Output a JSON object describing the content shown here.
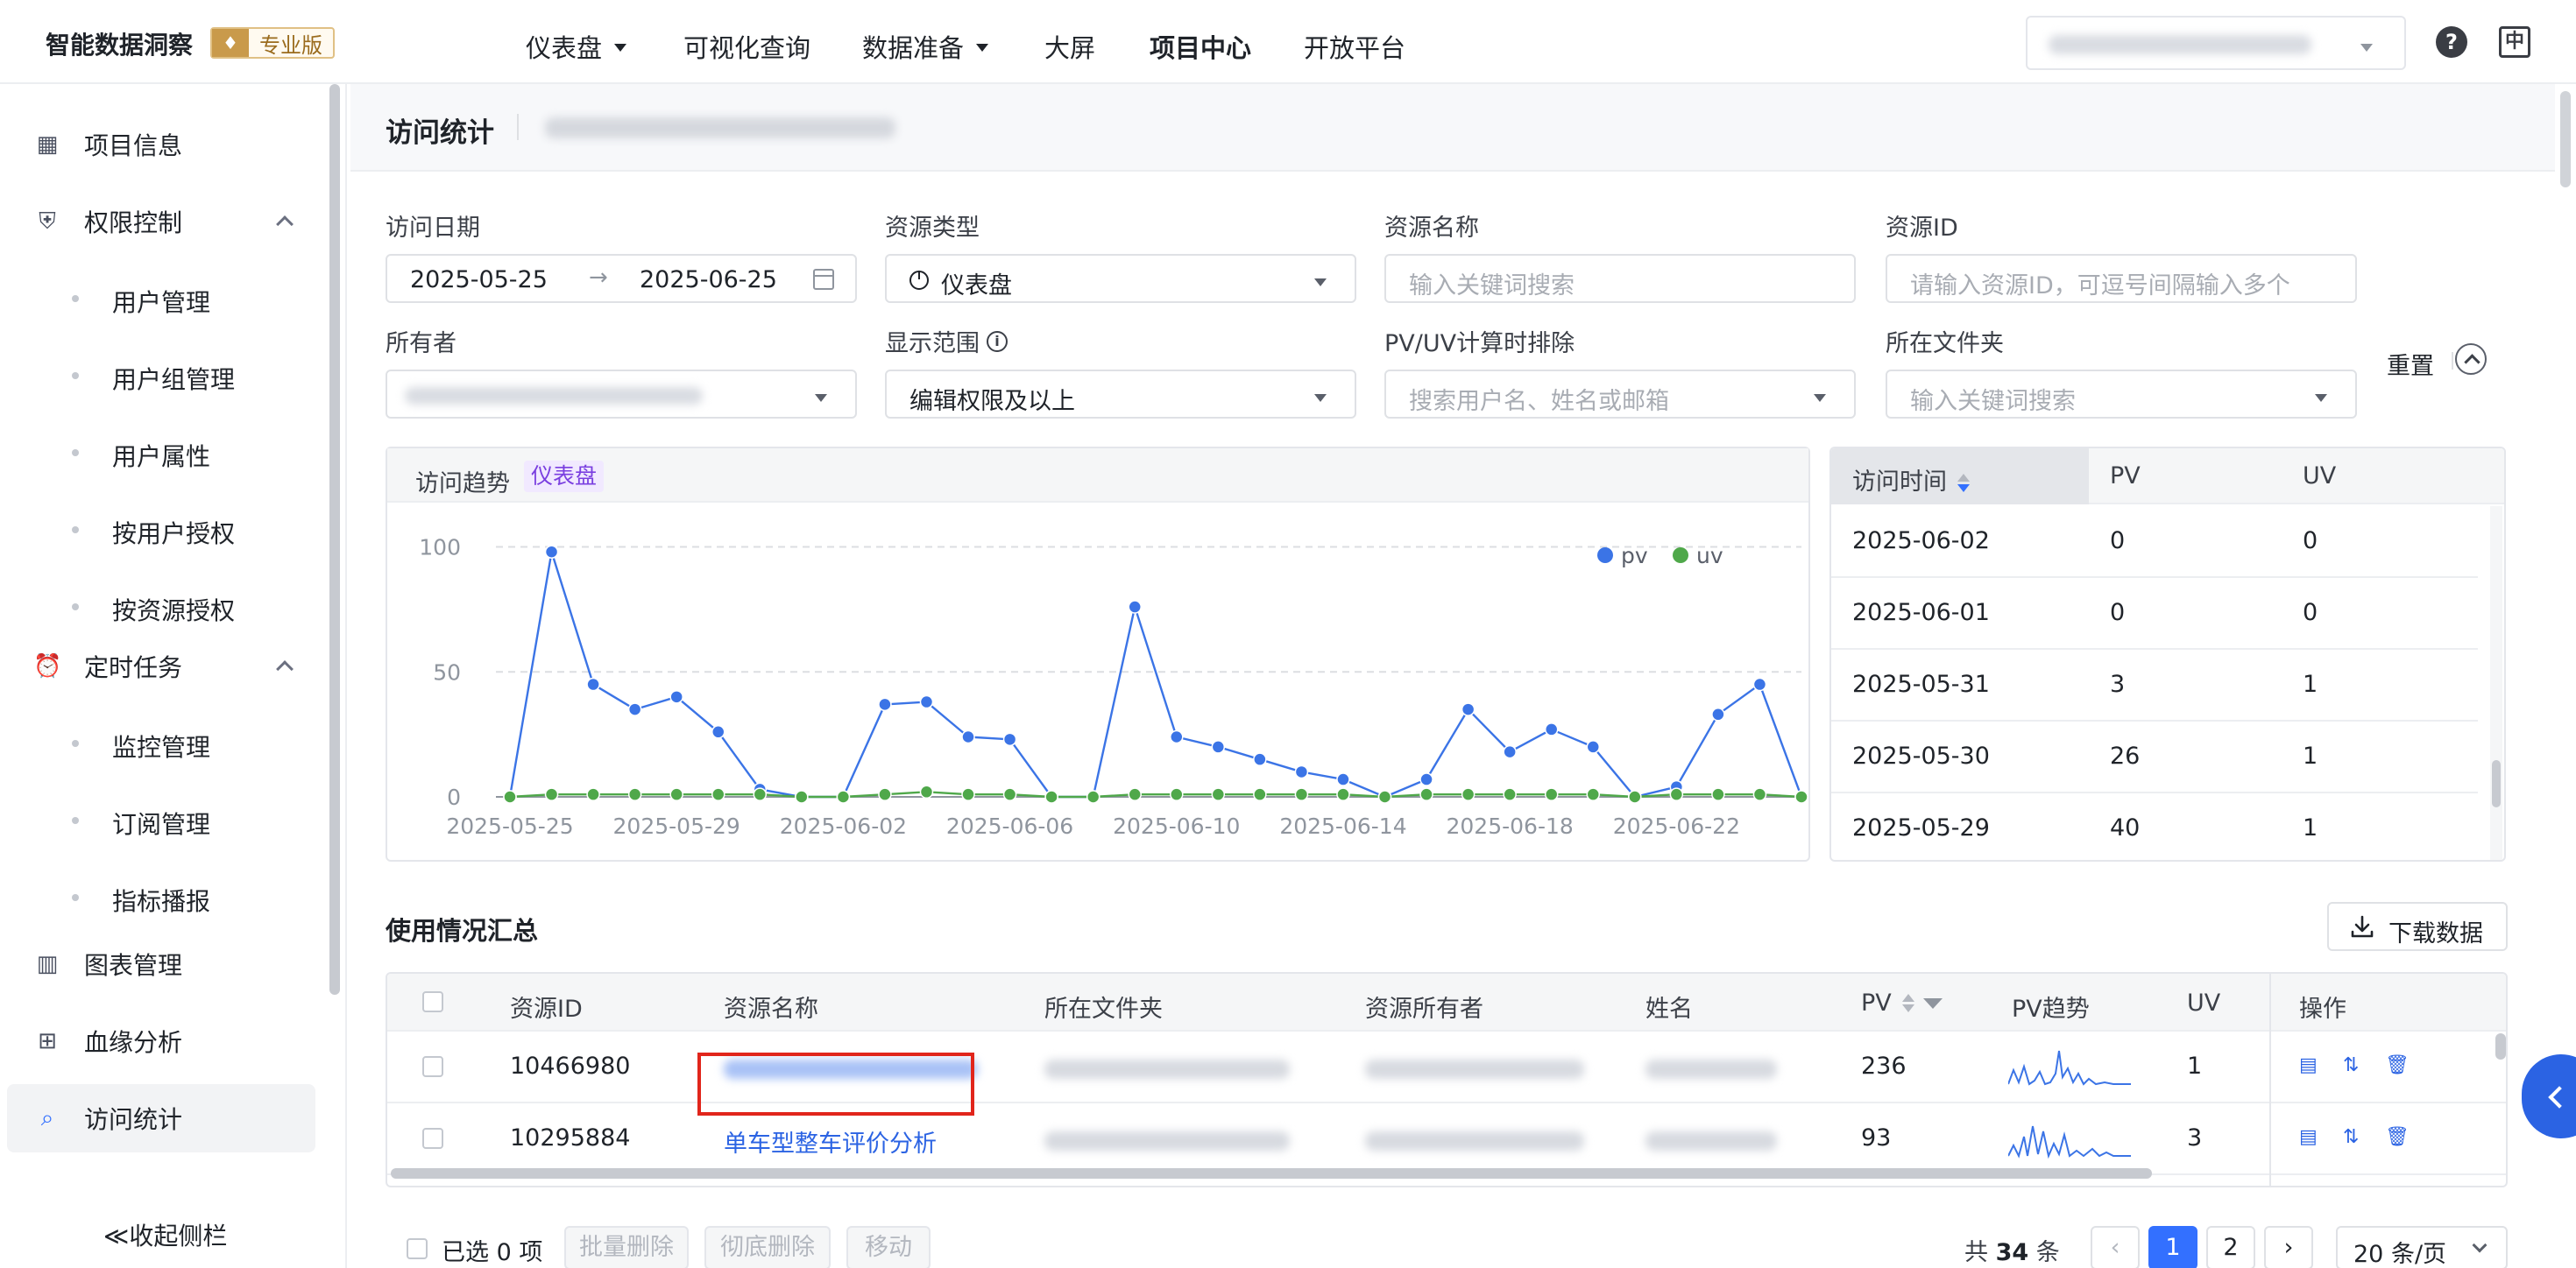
{
  "topnav": {
    "brand": "智能数据洞察",
    "edition": "专业版",
    "items": [
      "仪表盘",
      "可视化查询",
      "数据准备",
      "大屏",
      "项目中心",
      "开放平台"
    ],
    "help_icon": "question-circle-icon",
    "lang_icon": "chinese-language-icon"
  },
  "sidebar": {
    "items": [
      {
        "label": "项目信息",
        "icon": "grid-icon"
      },
      {
        "label": "权限控制",
        "icon": "shield-icon"
      },
      {
        "label": "用户管理"
      },
      {
        "label": "用户组管理"
      },
      {
        "label": "用户属性"
      },
      {
        "label": "按用户授权"
      },
      {
        "label": "按资源授权"
      },
      {
        "label": "定时任务",
        "icon": "alarm-clock-icon"
      },
      {
        "label": "监控管理"
      },
      {
        "label": "订阅管理"
      },
      {
        "label": "指标播报"
      },
      {
        "label": "图表管理",
        "icon": "bar-chart-icon"
      },
      {
        "label": "血缘分析",
        "icon": "lineage-icon"
      },
      {
        "label": "访问统计",
        "icon": "stats-search-icon"
      }
    ],
    "collapse_label": "≪收起侧栏"
  },
  "page": {
    "title": "访问统计"
  },
  "filters": {
    "date_label": "访问日期",
    "date_start": "2025-05-25",
    "date_arrow": "→",
    "date_end": "2025-06-25",
    "type_label": "资源类型",
    "type_value": "仪表盘",
    "name_label": "资源名称",
    "name_placeholder": "输入关键词搜索",
    "id_label": "资源ID",
    "id_placeholder": "请输入资源ID，可逗号间隔输入多个",
    "reset": "重置",
    "owner_label": "所有者",
    "scope_label": "显示范围",
    "scope_value": "编辑权限及以上",
    "exclude_label": "PV/UV计算时排除",
    "exclude_placeholder": "搜索用户名、姓名或邮箱",
    "folder_label": "所在文件夹",
    "folder_placeholder": "输入关键词搜索"
  },
  "trend": {
    "title": "访问趋势",
    "tag": "仪表盘"
  },
  "chart_data": {
    "type": "line",
    "x": [
      "2025-05-25",
      "2025-05-26",
      "2025-05-27",
      "2025-05-28",
      "2025-05-29",
      "2025-05-30",
      "2025-05-31",
      "2025-06-01",
      "2025-06-02",
      "2025-06-03",
      "2025-06-04",
      "2025-06-05",
      "2025-06-06",
      "2025-06-07",
      "2025-06-08",
      "2025-06-09",
      "2025-06-10",
      "2025-06-11",
      "2025-06-12",
      "2025-06-13",
      "2025-06-14",
      "2025-06-15",
      "2025-06-16",
      "2025-06-17",
      "2025-06-18",
      "2025-06-19",
      "2025-06-20",
      "2025-06-21",
      "2025-06-22",
      "2025-06-23",
      "2025-06-24",
      "2025-06-25"
    ],
    "xticks": [
      "2025-05-25",
      "2025-05-29",
      "2025-06-02",
      "2025-06-06",
      "2025-06-10",
      "2025-06-14",
      "2025-06-18",
      "2025-06-22"
    ],
    "series": [
      {
        "name": "pv",
        "color": "#3b74e6",
        "values": [
          0,
          98,
          45,
          35,
          40,
          26,
          3,
          0,
          0,
          37,
          38,
          24,
          23,
          0,
          0,
          76,
          24,
          20,
          15,
          10,
          7,
          0,
          7,
          35,
          18,
          27,
          20,
          0,
          4,
          33,
          45,
          0
        ]
      },
      {
        "name": "uv",
        "color": "#4fa84a",
        "values": [
          0,
          1,
          1,
          1,
          1,
          1,
          1,
          0,
          0,
          1,
          2,
          1,
          1,
          0,
          0,
          1,
          1,
          1,
          1,
          1,
          1,
          0,
          1,
          1,
          1,
          1,
          1,
          0,
          1,
          1,
          1,
          0
        ]
      }
    ],
    "yticks": [
      0,
      50,
      100
    ],
    "ylim": [
      0,
      110
    ],
    "grid": true,
    "legend": "top-right"
  },
  "stats_table": {
    "columns": [
      "访问时间",
      "PV",
      "UV"
    ],
    "rows": [
      [
        "2025-06-02",
        "0",
        "0"
      ],
      [
        "2025-06-01",
        "0",
        "0"
      ],
      [
        "2025-05-31",
        "3",
        "1"
      ],
      [
        "2025-05-30",
        "26",
        "1"
      ],
      [
        "2025-05-29",
        "40",
        "1"
      ]
    ]
  },
  "summary": {
    "title": "使用情况汇总",
    "download": "下载数据",
    "columns": [
      "资源ID",
      "资源名称",
      "所在文件夹",
      "资源所有者",
      "姓名",
      "PV",
      "PV趋势",
      "UV",
      "操作"
    ],
    "rows": [
      {
        "id": "10466980",
        "name": "",
        "pv": "236",
        "uv": "1"
      },
      {
        "id": "10295884",
        "name": "单车型整车评价分析",
        "pv": "93",
        "uv": "3"
      }
    ]
  },
  "footer": {
    "selected": "已选 0 项",
    "bulk_delete": "批量删除",
    "purge": "彻底删除",
    "move": "移动",
    "total_prefix": "共",
    "total_count": "34",
    "total_suffix": "条",
    "pages": [
      "1",
      "2"
    ],
    "page_size": "20 条/页"
  }
}
